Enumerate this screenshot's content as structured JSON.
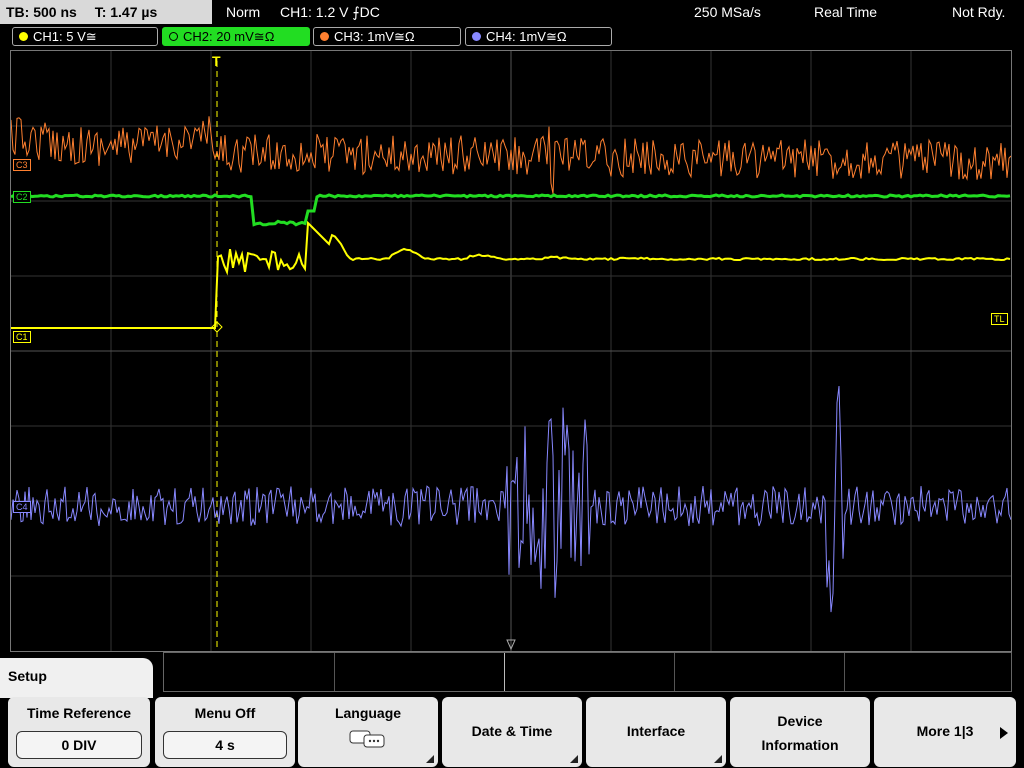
{
  "topbar": {
    "timebase": "TB: 500 ns",
    "trigger_time": "T: 1.47 µs",
    "mode": "Norm",
    "trigger_info": "CH1: 1.2 V ⨍DC",
    "sample_rate": "250 MSa/s",
    "acq_mode": "Real Time",
    "status": "Not Rdy."
  },
  "channels": [
    {
      "label": "CH1: 5 V≅",
      "color": "#ffff00"
    },
    {
      "label": "CH2: 20 mV≅Ω",
      "color": "#22dd22"
    },
    {
      "label": "CH3: 1mV≅Ω",
      "color": "#ff8030"
    },
    {
      "label": "CH4: 1mV≅Ω",
      "color": "#8888ff"
    }
  ],
  "markers": {
    "c1": "C1",
    "c2": "C2",
    "c3": "C3",
    "c4": "C4",
    "tl": "TL",
    "trigger": "T"
  },
  "menu": {
    "title": "Setup",
    "buttons": [
      {
        "label": "Time Reference",
        "value": "0 DIV"
      },
      {
        "label": "Menu Off",
        "value": "4 s"
      },
      {
        "label": "Language",
        "icon": "speech-bubble-icon"
      },
      {
        "label": "Date & Time"
      },
      {
        "label": "Interface"
      },
      {
        "label_line1": "Device",
        "label_line2": "Information"
      },
      {
        "label": "More 1|3"
      }
    ]
  }
}
